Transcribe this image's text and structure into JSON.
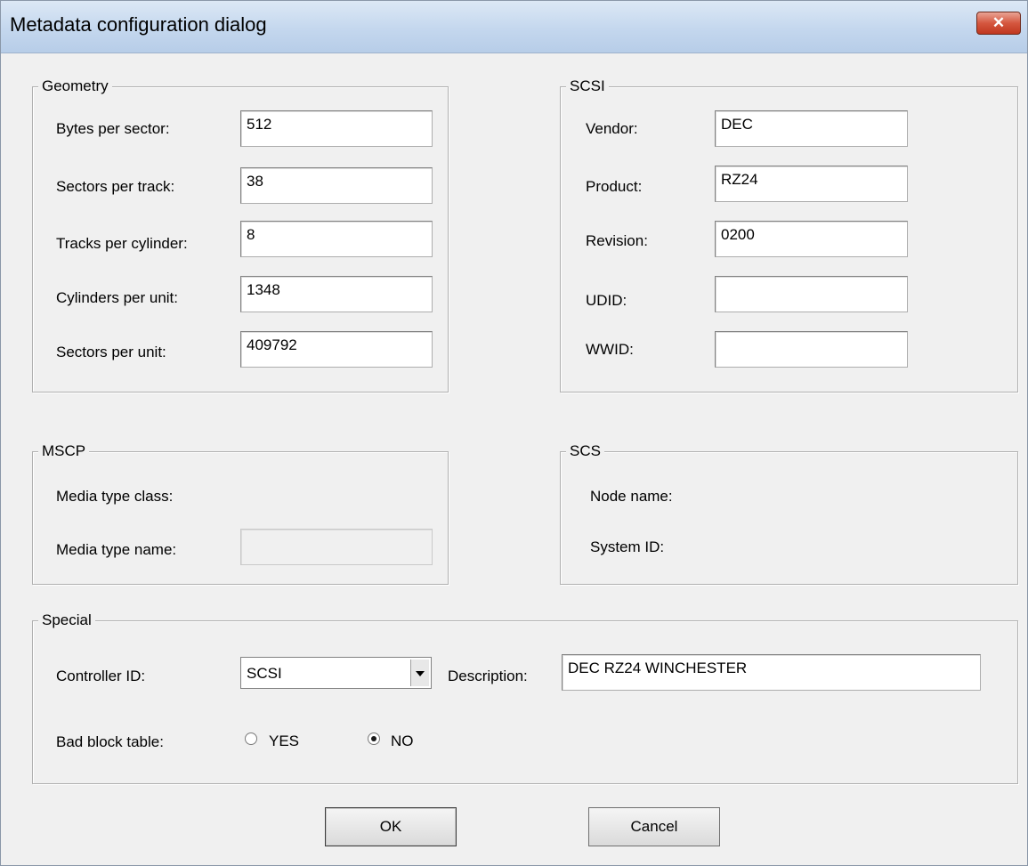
{
  "window": {
    "title": "Metadata configuration dialog",
    "close_label": "✕"
  },
  "geometry": {
    "legend": "Geometry",
    "fields": [
      {
        "label": "Bytes per sector:",
        "value": "512"
      },
      {
        "label": "Sectors per track:",
        "value": "38"
      },
      {
        "label": "Tracks per cylinder:",
        "value": "8"
      },
      {
        "label": "Cylinders per unit:",
        "value": "1348"
      },
      {
        "label": "Sectors per unit:",
        "value": "409792"
      }
    ]
  },
  "scsi": {
    "legend": "SCSI",
    "fields": [
      {
        "label": "Vendor:",
        "value": "DEC"
      },
      {
        "label": "Product:",
        "value": "RZ24"
      },
      {
        "label": "Revision:",
        "value": "0200"
      },
      {
        "label": "UDID:",
        "value": ""
      },
      {
        "label": "WWID:",
        "value": ""
      }
    ]
  },
  "mscp": {
    "legend": "MSCP",
    "media_type_class_label": "Media type class:",
    "media_type_name_label": "Media type name:",
    "media_type_name_value": ""
  },
  "scs": {
    "legend": "SCS",
    "node_name_label": "Node name:",
    "system_id_label": "System ID:"
  },
  "special": {
    "legend": "Special",
    "controller_id_label": "Controller ID:",
    "controller_id_value": "SCSI",
    "description_label": "Description:",
    "description_value": "DEC RZ24 WINCHESTER",
    "bad_block_label": "Bad block table:",
    "yes_label": "YES",
    "no_label": "NO",
    "bad_block_selected": "NO"
  },
  "buttons": {
    "ok": "OK",
    "cancel": "Cancel"
  }
}
